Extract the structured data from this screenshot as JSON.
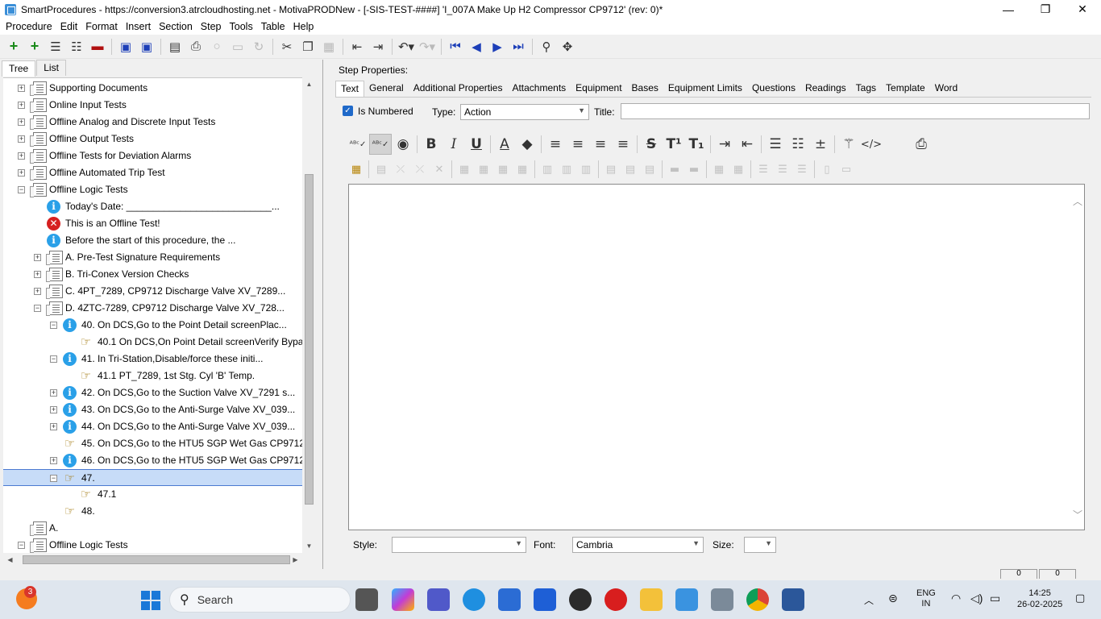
{
  "window": {
    "title": "SmartProcedures - https://conversion3.atrcloudhosting.net - MotivaPRODNew - [-SIS-TEST-####] 'I_007A Make Up H2 Compressor CP9712' (rev: 0)*",
    "minimize": "—",
    "maximize": "❐",
    "close": "✕"
  },
  "menu": [
    "Procedure",
    "Edit",
    "Format",
    "Insert",
    "Section",
    "Step",
    "Tools",
    "Table",
    "Help"
  ],
  "left_tabs": [
    "Tree",
    "List"
  ],
  "tree": [
    {
      "label": "Supporting Documents",
      "icon": "doc",
      "level": 0,
      "expander": "+"
    },
    {
      "label": "Online Input Tests",
      "icon": "doc",
      "level": 0,
      "expander": "+"
    },
    {
      "label": "Offline Analog and Discrete Input Tests",
      "icon": "doc",
      "level": 0,
      "expander": "+"
    },
    {
      "label": "Offline Output Tests",
      "icon": "doc",
      "level": 0,
      "expander": "+"
    },
    {
      "label": "Offline Tests for Deviation Alarms",
      "icon": "doc",
      "level": 0,
      "expander": "+"
    },
    {
      "label": "Offline Automated Trip Test",
      "icon": "doc",
      "level": 0,
      "expander": "+"
    },
    {
      "label": "Offline Logic Tests",
      "icon": "doc",
      "level": 0,
      "expander": "−"
    },
    {
      "label": "Today's Date: ___________________________...",
      "icon": "info",
      "level": 1,
      "expander": ""
    },
    {
      "label": "This is an Offline Test!",
      "icon": "err",
      "level": 1,
      "expander": ""
    },
    {
      "label": "Before the start of this procedure, the ...",
      "icon": "info",
      "level": 1,
      "expander": ""
    },
    {
      "label": "A. Pre-Test Signature Requirements",
      "icon": "doc",
      "level": 1,
      "expander": "+"
    },
    {
      "label": "B. Tri-Conex Version Checks",
      "icon": "doc",
      "level": 1,
      "expander": "+"
    },
    {
      "label": "C. 4PT_7289, CP9712 Discharge Valve XV_7289...",
      "icon": "doc",
      "level": 1,
      "expander": "+"
    },
    {
      "label": "D. 4ZTC-7289, CP9712 Discharge Valve XV_728...",
      "icon": "doc",
      "level": 1,
      "expander": "−"
    },
    {
      "label": "40. On DCS,Go to the Point Detail screenPlac...",
      "icon": "info",
      "level": 2,
      "expander": "−"
    },
    {
      "label": "40.1 On DCS,On Point Detail screenVerify Bypa...",
      "icon": "hand",
      "level": 3,
      "expander": ""
    },
    {
      "label": "41. In Tri-Station,Disable/force these initi...",
      "icon": "info",
      "level": 2,
      "expander": "−"
    },
    {
      "label": "41.1 PT_7289, 1st Stg. Cyl 'B' Temp.",
      "icon": "hand",
      "level": 3,
      "expander": ""
    },
    {
      "label": "42. On DCS,Go to the Suction Valve XV_7291 s...",
      "icon": "info",
      "level": 2,
      "expander": "+"
    },
    {
      "label": "43. On DCS,Go to the Anti-Surge Valve XV_039...",
      "icon": "info",
      "level": 2,
      "expander": "+"
    },
    {
      "label": "44. On DCS,Go to the Anti-Surge Valve XV_039...",
      "icon": "info",
      "level": 2,
      "expander": "+"
    },
    {
      "label": "45. On DCS,Go to the HTU5 SGP Wet Gas CP9712...",
      "icon": "hand",
      "level": 2,
      "expander": ""
    },
    {
      "label": "46. On DCS,Go to the HTU5 SGP Wet Gas CP9712...",
      "icon": "info",
      "level": 2,
      "expander": "+"
    },
    {
      "label": "47.",
      "icon": "hand",
      "level": 2,
      "expander": "−",
      "selected": true
    },
    {
      "label": "47.1",
      "icon": "hand",
      "level": 3,
      "expander": ""
    },
    {
      "label": "48.",
      "icon": "hand",
      "level": 2,
      "expander": ""
    },
    {
      "label": "A.",
      "icon": "doc",
      "level": 0,
      "expander": ""
    },
    {
      "label": "Offline Logic Tests",
      "icon": "doc",
      "level": 0,
      "expander": "−"
    }
  ],
  "step_properties": {
    "heading": "Step Properties:",
    "tabs": [
      "Text",
      "General",
      "Additional Properties",
      "Attachments",
      "Equipment",
      "Bases",
      "Equipment Limits",
      "Questions",
      "Readings",
      "Tags",
      "Template",
      "Word"
    ],
    "is_numbered_label": "Is Numbered",
    "type_label": "Type:",
    "type_value": "Action",
    "title_label": "Title:",
    "title_value": ""
  },
  "format_bottom": {
    "style_label": "Style:",
    "style_value": "",
    "font_label": "Font:",
    "font_value": "Cambria",
    "size_label": "Size:",
    "size_value": ""
  },
  "status": {
    "left_value": "0",
    "right_value": "0"
  },
  "taskbar": {
    "weather_badge": "3",
    "search_placeholder": "Search",
    "language": "ENG",
    "region": "IN",
    "time": "14:25",
    "date": "26-02-2025"
  },
  "colors": {
    "selection": "#c7dcf8",
    "info_icon": "#2aa0e8",
    "error_icon": "#d62020",
    "accent": "#1f69c9"
  }
}
